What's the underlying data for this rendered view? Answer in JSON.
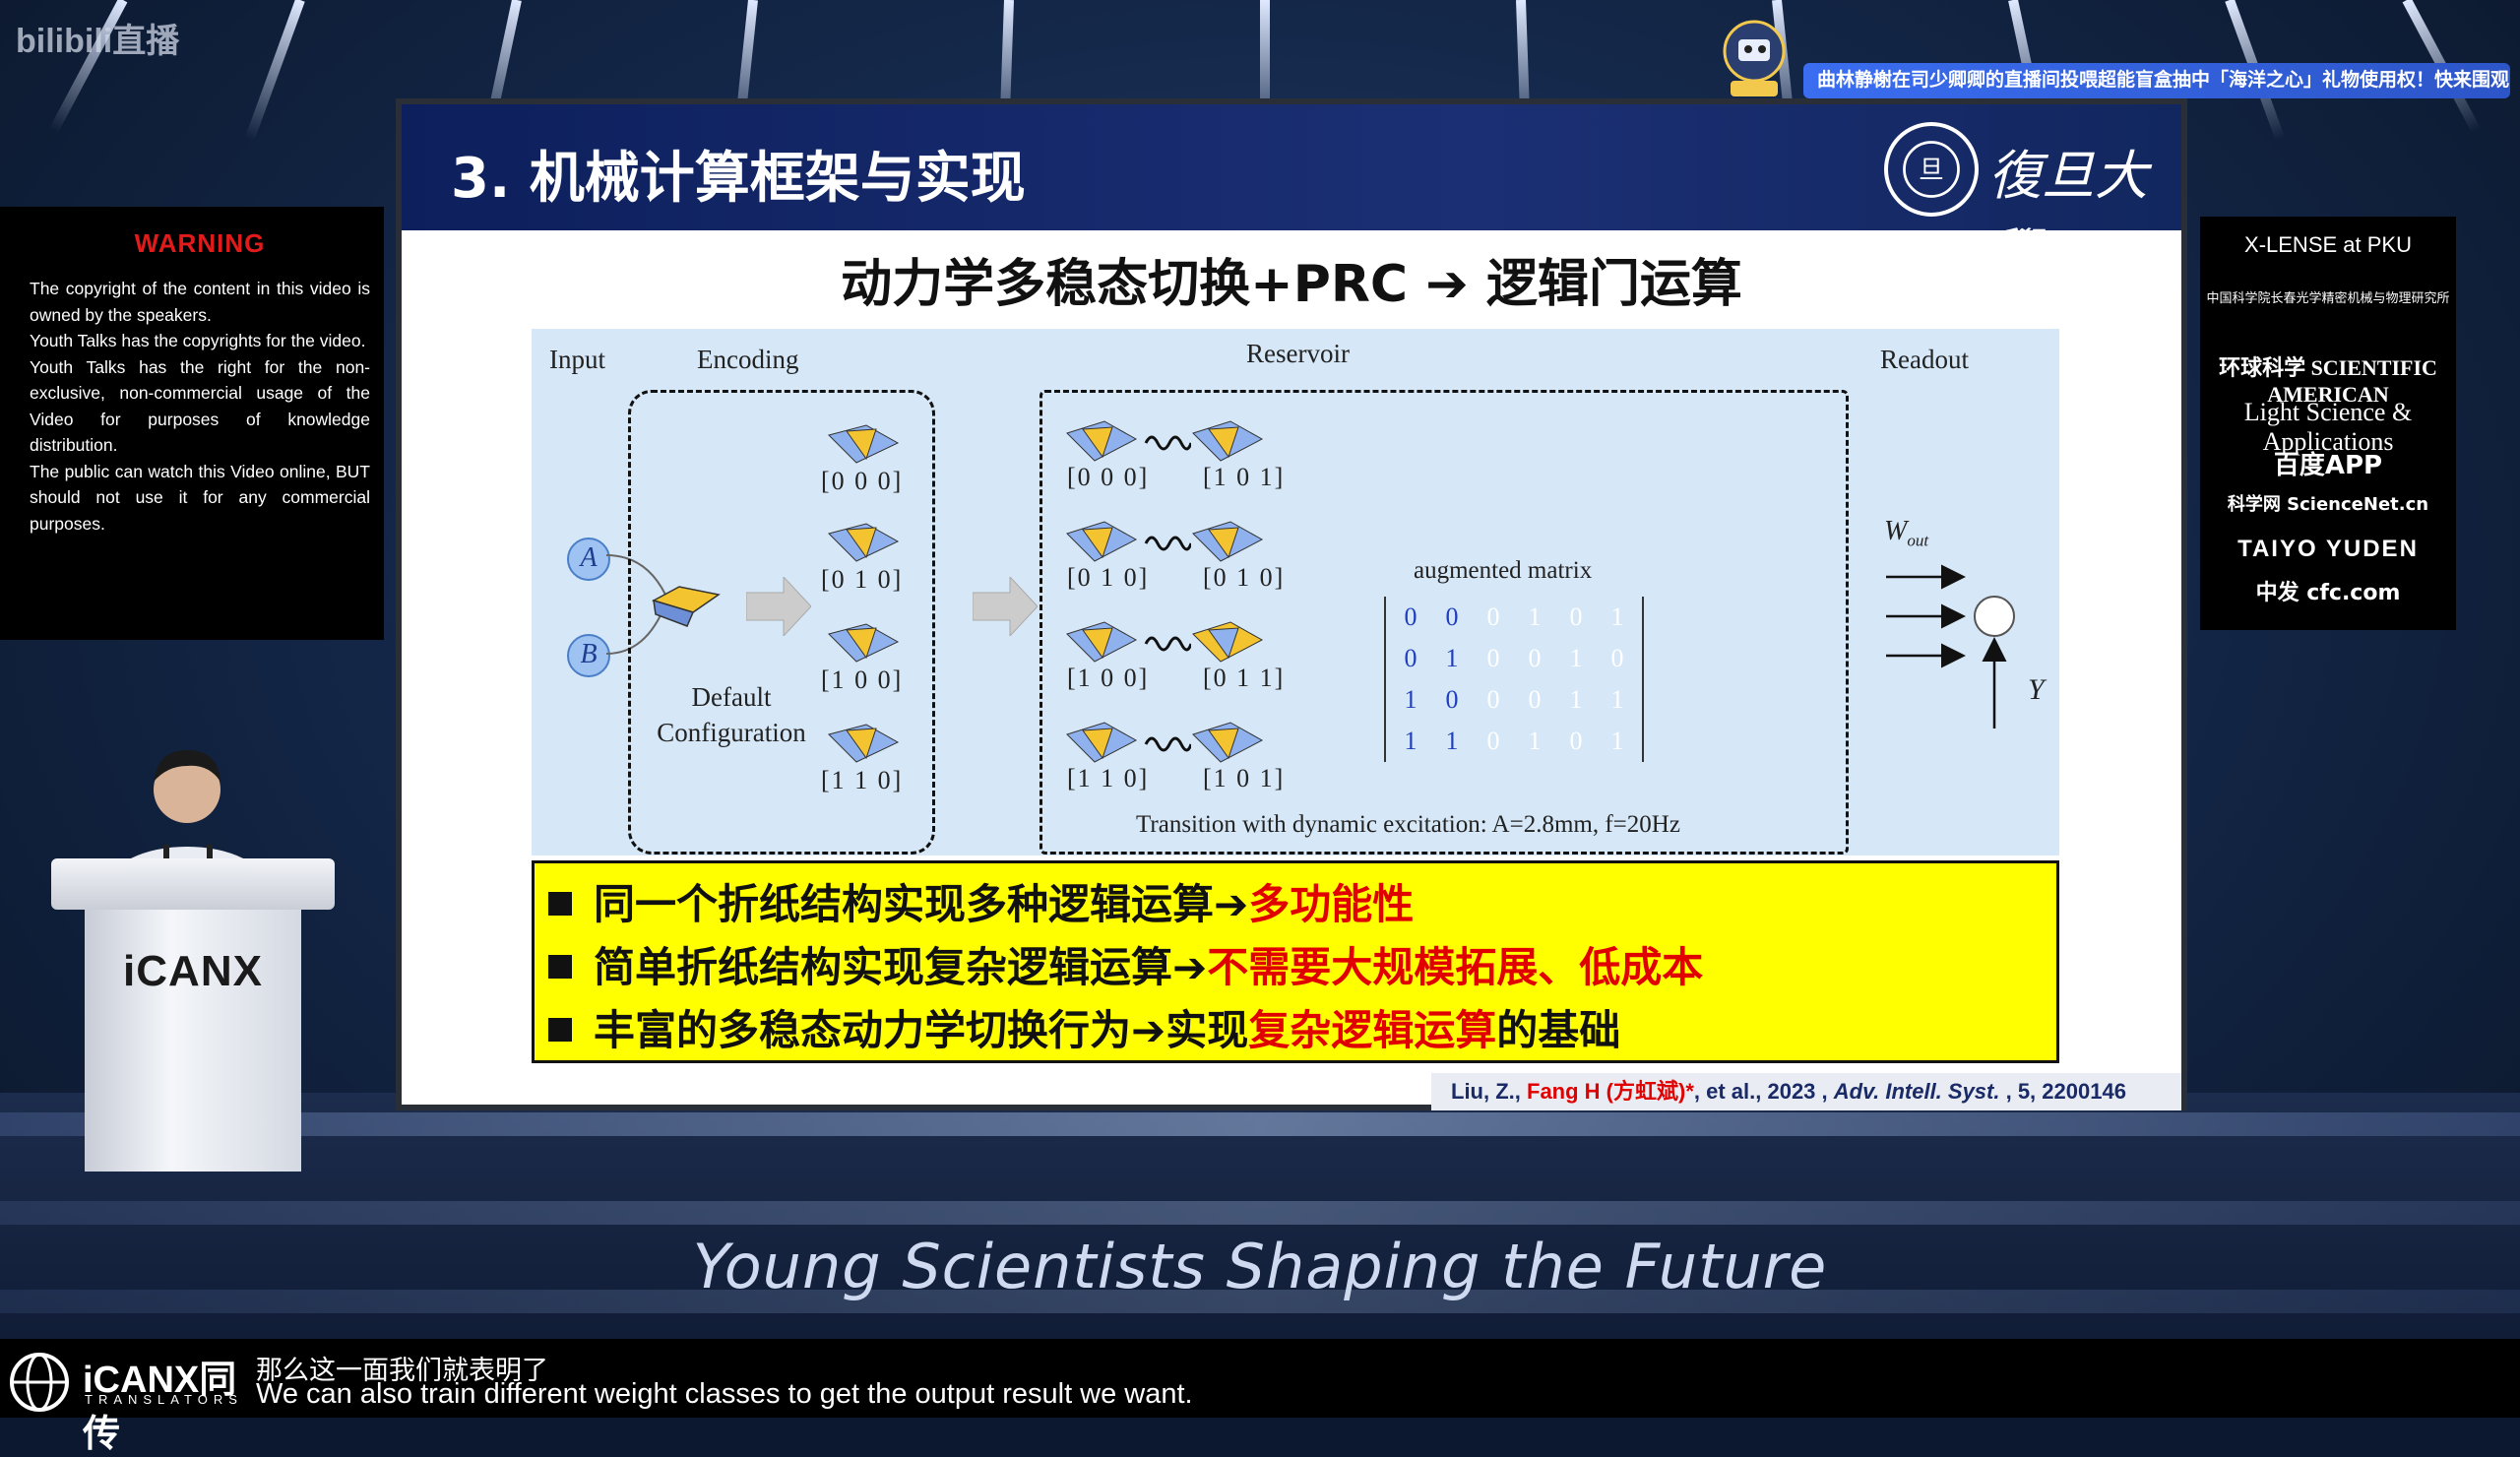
{
  "stream": {
    "platform_logo": "bilibili直播",
    "gift_banner": "曲林静榭在司少卿卿的直播间投喂超能盲盒抽中「海洋之心」礼物使用权！快来围观吧～～"
  },
  "warning": {
    "title": "WARNING",
    "lines": [
      "The copyright of the content in this video is owned by the speakers.",
      "Youth Talks has  the copyrights for the video.",
      "Youth Talks has the right for the non-exclusive, non-commercial usage of the Video for purposes of knowledge distribution.",
      "The public can watch this Video online, BUT should not use it for any commercial purposes."
    ]
  },
  "sponsors": [
    "X-LENSE at PKU",
    "中国科学院长春光学精密机械与物理研究所",
    "环球科学 SCIENTIFIC AMERICAN",
    "Light Science & Applications",
    "百度APP",
    "科学网 ScienceNet.cn",
    "TAIYO YUDEN",
    "中发 cfc.com"
  ],
  "slide": {
    "title": "3. 机械计算框架与实现",
    "university": "復旦大學",
    "subtitle": "动力学多稳态切换+PRC ➔ 逻辑门运算",
    "diagram": {
      "input_label": "Input",
      "encoding_label": "Encoding",
      "reservoir_label": "Reservoir",
      "readout_label": "Readout",
      "node_a": "A",
      "node_b": "B",
      "default_config": "Default Configuration",
      "encoding_codes": [
        "[0 0 0]",
        "[0 1 0]",
        "[1 0 0]",
        "[1 1 0]"
      ],
      "reservoir_left_codes": [
        "[0 0 0]",
        "[0 1 0]",
        "[1 0 0]",
        "[1 1 0]"
      ],
      "reservoir_right_codes": [
        "[1 0 1]",
        "[0 1 0]",
        "[0 1 1]",
        "[1 0 1]"
      ],
      "matrix_title": "augmented matrix",
      "matrix": [
        [
          "0",
          "0",
          "0",
          "1",
          "0",
          "1"
        ],
        [
          "0",
          "1",
          "0",
          "0",
          "1",
          "0"
        ],
        [
          "1",
          "0",
          "0",
          "0",
          "1",
          "1"
        ],
        [
          "1",
          "1",
          "0",
          "1",
          "0",
          "1"
        ]
      ],
      "transition_text": "Transition with dynamic excitation: A=2.8mm, f=20Hz",
      "w_out": "W",
      "w_out_sub": "out",
      "y_label": "Y"
    },
    "bullets": [
      {
        "normal": "同一个折纸结构实现多种逻辑运算➔",
        "red": "多功能性",
        "tail": ""
      },
      {
        "normal": "简单折纸结构实现复杂逻辑运算➔",
        "red": "不需要大规模拓展、低成本",
        "tail": ""
      },
      {
        "normal": "丰富的多稳态动力学切换行为➔实现",
        "red": "复杂逻辑运算",
        "tail": "的基础"
      }
    ],
    "citation": {
      "author1": "Liu, Z., ",
      "author2": "Fang H (方虹斌)*",
      "rest": ", et al., 2023 , ",
      "journal": "Adv. Intell. Syst.",
      "volume": " , 5, 2200146"
    }
  },
  "podium_logo": "iCANX",
  "tagline": "Young Scientists Shaping the Future",
  "subtitles": {
    "brand": "iCANX同传",
    "brand_sub": "TRANSLATORS",
    "zh": "那么这一面我们就表明了",
    "en": "We can also train different weight classes to get the output result we want."
  },
  "colors": {
    "slide_header": "#1b2f74",
    "highlight": "#ffff00",
    "accent_red": "#e00000",
    "matrix_blue": "#1f3fbf"
  }
}
